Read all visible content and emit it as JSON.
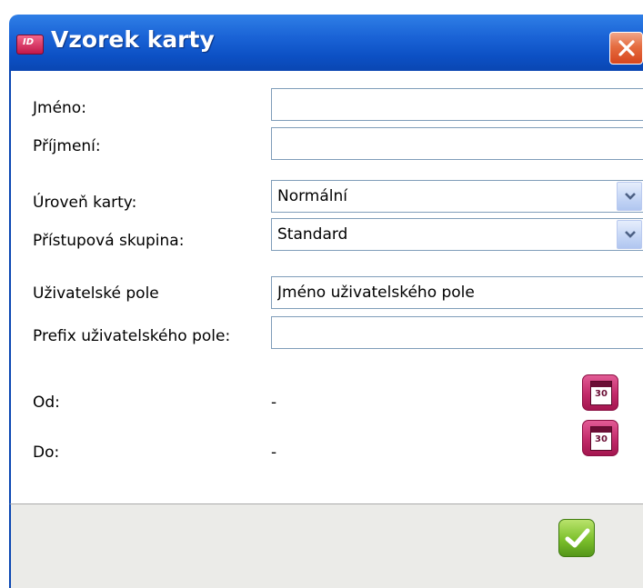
{
  "window": {
    "title": "Vzorek karty",
    "close_symbol": "×"
  },
  "form": {
    "first_name": {
      "label": "Jméno:",
      "value": ""
    },
    "last_name": {
      "label": "Příjmení:",
      "value": ""
    },
    "card_level": {
      "label": "Úroveň karty:",
      "value": "Normální"
    },
    "access_group": {
      "label": "Přístupová skupina:",
      "value": "Standard"
    },
    "user_field": {
      "label": "Uživatelské pole",
      "value": "Jméno uživatelského pole"
    },
    "user_field_prefix": {
      "label": "Prefix uživatelského pole:",
      "value": ""
    },
    "valid_from": {
      "label": "Od:",
      "value": "-"
    },
    "valid_to": {
      "label": "Do:",
      "value": "-"
    }
  },
  "calendar_icon_text": "30",
  "icons": {
    "app": "card-id-icon",
    "close": "close-x-icon",
    "dropdown": "chevron-down-icon",
    "calendar": "calendar-icon",
    "confirm": "checkmark-icon"
  },
  "colors": {
    "titlebar": "#0c50c4",
    "close_button": "#e56c40",
    "calendar_button": "#c22a6a",
    "confirm_button": "#7cc02c",
    "footer": "#ebebe8"
  }
}
